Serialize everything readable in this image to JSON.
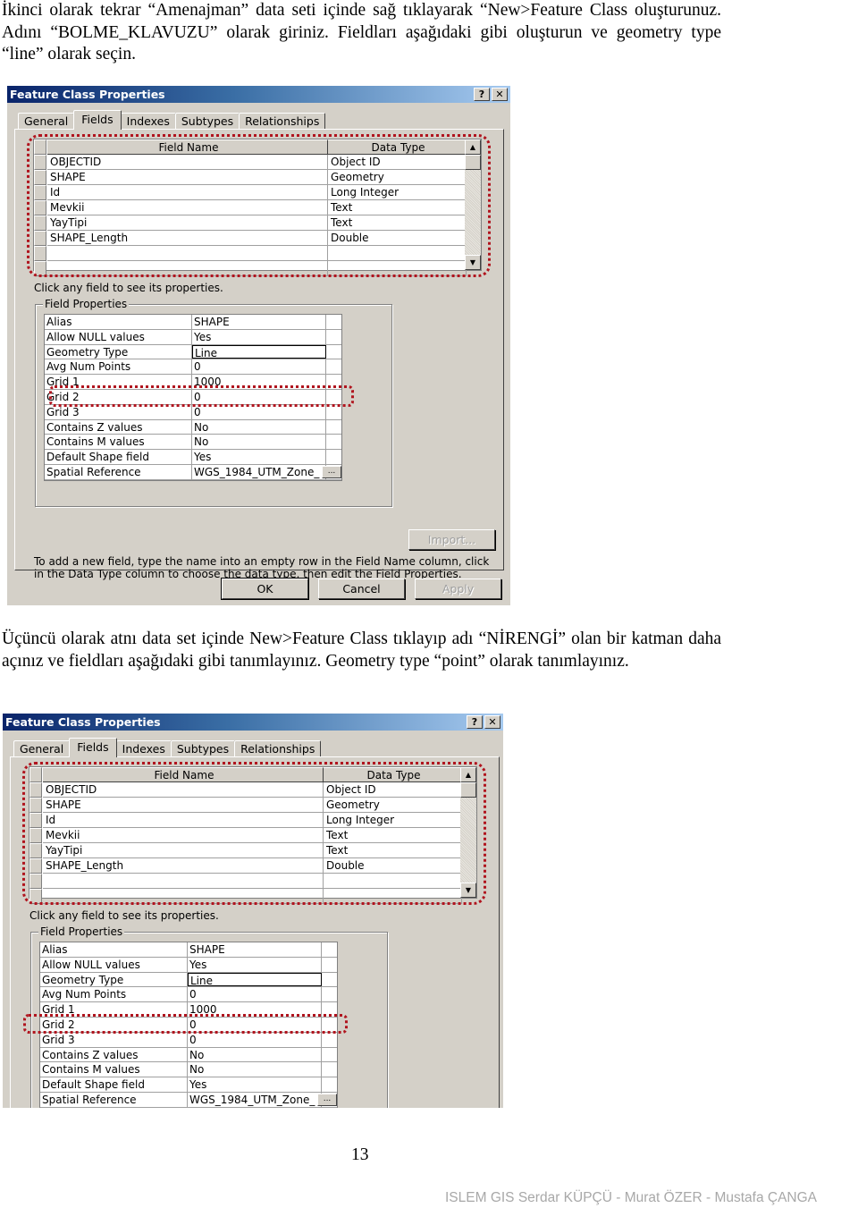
{
  "paragraphs": {
    "p1": "İkinci olarak tekrar “Amenajman” data seti içinde sağ tıklayarak “New>Feature Class oluşturunuz. Adını “BOLME_KLAVUZU” olarak giriniz. Fieldları aşağıdaki gibi oluşturun ve geometry type “line” olarak seçin.",
    "p2": "Üçüncü olarak atnı data set içinde New>Feature Class tıklayıp adı “NİRENGİ” olan bir katman daha açınız ve fieldları aşağıdaki gibi tanımlayınız. Geometry type “point” olarak tanımlayınız."
  },
  "dialogs": [
    {
      "title": "Feature Class Properties",
      "help_button": "?",
      "close_button": "✕",
      "tabs": [
        {
          "label": "General"
        },
        {
          "label": "Fields",
          "active": true
        },
        {
          "label": "Indexes"
        },
        {
          "label": "Subtypes"
        },
        {
          "label": "Relationships"
        }
      ],
      "grid": {
        "headers": {
          "name": "Field Name",
          "type": "Data Type"
        },
        "rows": [
          {
            "name": "OBJECTID",
            "type": "Object ID"
          },
          {
            "name": "SHAPE",
            "type": "Geometry"
          },
          {
            "name": "Id",
            "type": "Long Integer"
          },
          {
            "name": "Mevkii",
            "type": "Text"
          },
          {
            "name": "YayTipi",
            "type": "Text"
          },
          {
            "name": "SHAPE_Length",
            "type": "Double"
          },
          {
            "name": "",
            "type": ""
          },
          {
            "name": "",
            "type": ""
          }
        ]
      },
      "hint": "Click any field to see its properties.",
      "field_properties_label": "Field Properties",
      "properties": [
        {
          "key": "Alias",
          "value": "SHAPE"
        },
        {
          "key": "Allow NULL values",
          "value": "Yes"
        },
        {
          "key": "Geometry Type",
          "value": "Line"
        },
        {
          "key": "Avg Num Points",
          "value": "0"
        },
        {
          "key": "Grid 1",
          "value": "1000"
        },
        {
          "key": "Grid 2",
          "value": "0"
        },
        {
          "key": "Grid 3",
          "value": "0"
        },
        {
          "key": "Contains Z values",
          "value": "No"
        },
        {
          "key": "Contains M values",
          "value": "No"
        },
        {
          "key": "Default Shape field",
          "value": "Yes"
        },
        {
          "key": "Spatial Reference",
          "value": "WGS_1984_UTM_Zone_"
        }
      ],
      "ellipsis_button": "...",
      "import_button": "Import...",
      "help_text": "To add a new field, type the name into an empty row in the Field Name column, click in the Data Type column to choose the data type, then edit the Field Properties.",
      "ok_button": "OK",
      "cancel_button": "Cancel",
      "apply_button": "Apply"
    },
    {
      "title": "Feature Class Properties",
      "help_button": "?",
      "close_button": "✕",
      "tabs": [
        {
          "label": "General"
        },
        {
          "label": "Fields",
          "active": true
        },
        {
          "label": "Indexes"
        },
        {
          "label": "Subtypes"
        },
        {
          "label": "Relationships"
        }
      ],
      "grid": {
        "headers": {
          "name": "Field Name",
          "type": "Data Type"
        },
        "rows": [
          {
            "name": "OBJECTID",
            "type": "Object ID"
          },
          {
            "name": "SHAPE",
            "type": "Geometry"
          },
          {
            "name": "Id",
            "type": "Long Integer"
          },
          {
            "name": "Mevkii",
            "type": "Text"
          },
          {
            "name": "YayTipi",
            "type": "Text"
          },
          {
            "name": "SHAPE_Length",
            "type": "Double"
          },
          {
            "name": "",
            "type": ""
          },
          {
            "name": "",
            "type": ""
          }
        ]
      },
      "hint": "Click any field to see its properties.",
      "field_properties_label": "Field Properties",
      "properties": [
        {
          "key": "Alias",
          "value": "SHAPE"
        },
        {
          "key": "Allow NULL values",
          "value": "Yes"
        },
        {
          "key": "Geometry Type",
          "value": "Line"
        },
        {
          "key": "Avg Num Points",
          "value": "0"
        },
        {
          "key": "Grid 1",
          "value": "1000"
        },
        {
          "key": "Grid 2",
          "value": "0"
        },
        {
          "key": "Grid 3",
          "value": "0"
        },
        {
          "key": "Contains Z values",
          "value": "No"
        },
        {
          "key": "Contains M values",
          "value": "No"
        },
        {
          "key": "Default Shape field",
          "value": "Yes"
        },
        {
          "key": "Spatial Reference",
          "value": "WGS_1984_UTM_Zone_"
        }
      ],
      "ellipsis_button": "..."
    }
  ],
  "page_number": "13",
  "footer": "ISLEM GIS  Serdar KÜPÇÜ - Murat ÖZER - Mustafa ÇANGA",
  "colors": {
    "highlight_outline": "#b0141e",
    "titlebar_start": "#0a246a",
    "titlebar_end": "#a6caf0",
    "dialog_bg": "#d4d0c8",
    "footer_text": "#a8a8a8"
  }
}
